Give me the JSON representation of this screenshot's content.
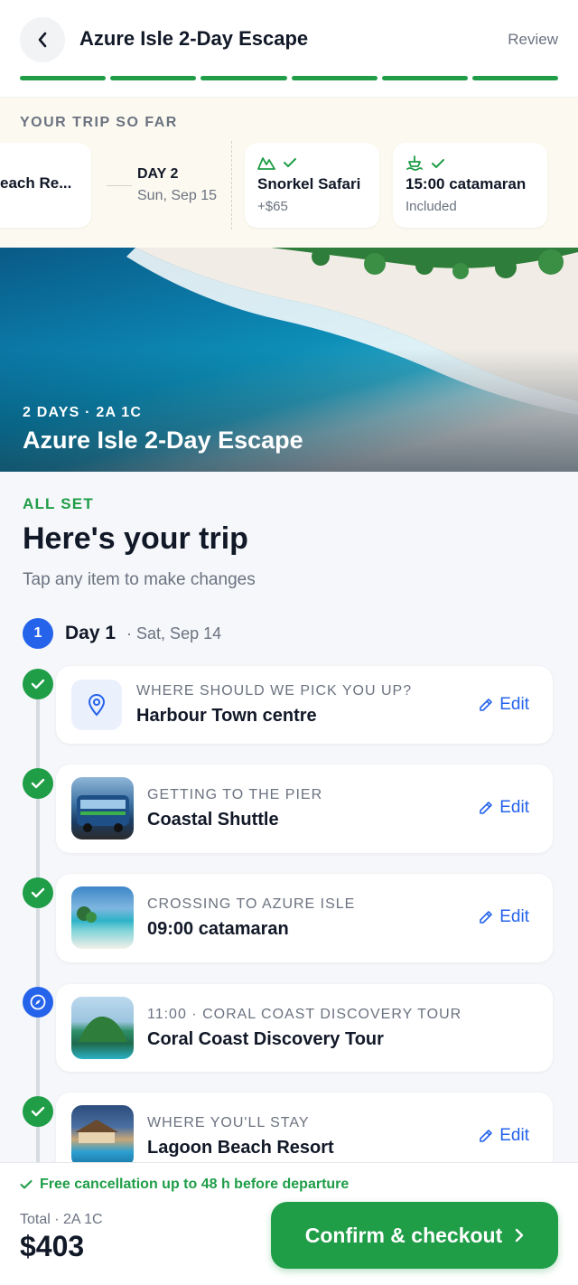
{
  "header": {
    "title": "Azure Isle 2-Day Escape",
    "review_label": "Review",
    "progress_steps_complete": 6,
    "progress_steps_total": 6
  },
  "trip_so_far": {
    "title": "YOUR TRIP SO FAR",
    "first_item": "each Re...",
    "day": {
      "label": "DAY 2",
      "date": "Sun, Sep 15"
    },
    "items": [
      {
        "name": "Snorkel Safari",
        "sub": "+$65",
        "icon": "mountain-icon"
      },
      {
        "name": "15:00 catamaran",
        "sub": "Included",
        "icon": "ferry-icon"
      }
    ]
  },
  "hero": {
    "subtitle": "2 DAYS · 2A 1C",
    "title": "Azure Isle 2-Day Escape"
  },
  "main": {
    "status": "ALL SET",
    "title": "Here's your trip",
    "subtitle": "Tap any item to make changes",
    "day": {
      "number": "1",
      "label": "Day 1",
      "date": "· Sat, Sep 14"
    },
    "edit_label": "Edit",
    "items": [
      {
        "kicker": "WHERE SHOULD WE PICK YOU UP?",
        "value": "Harbour Town centre",
        "status": "done"
      },
      {
        "kicker": "GETTING TO THE PIER",
        "value": "Coastal Shuttle",
        "status": "done"
      },
      {
        "kicker": "CROSSING TO AZURE ISLE",
        "value": "09:00 catamaran",
        "status": "done"
      },
      {
        "kicker": "11:00 · CORAL COAST DISCOVERY TOUR",
        "value": "Coral Coast Discovery Tour",
        "status": "current"
      },
      {
        "kicker": "WHERE YOU'LL STAY",
        "value": "Lagoon Beach Resort",
        "status": "done"
      }
    ]
  },
  "footer": {
    "cancellation": "Free cancellation up to 48 h before departure",
    "total_label": "Total · 2A 1C",
    "total_value": "$403",
    "confirm_label": "Confirm & checkout"
  },
  "colors": {
    "accent_green": "#1f9d47",
    "accent_blue": "#2563eb",
    "text_primary": "#111827",
    "text_muted": "#6b7280"
  }
}
